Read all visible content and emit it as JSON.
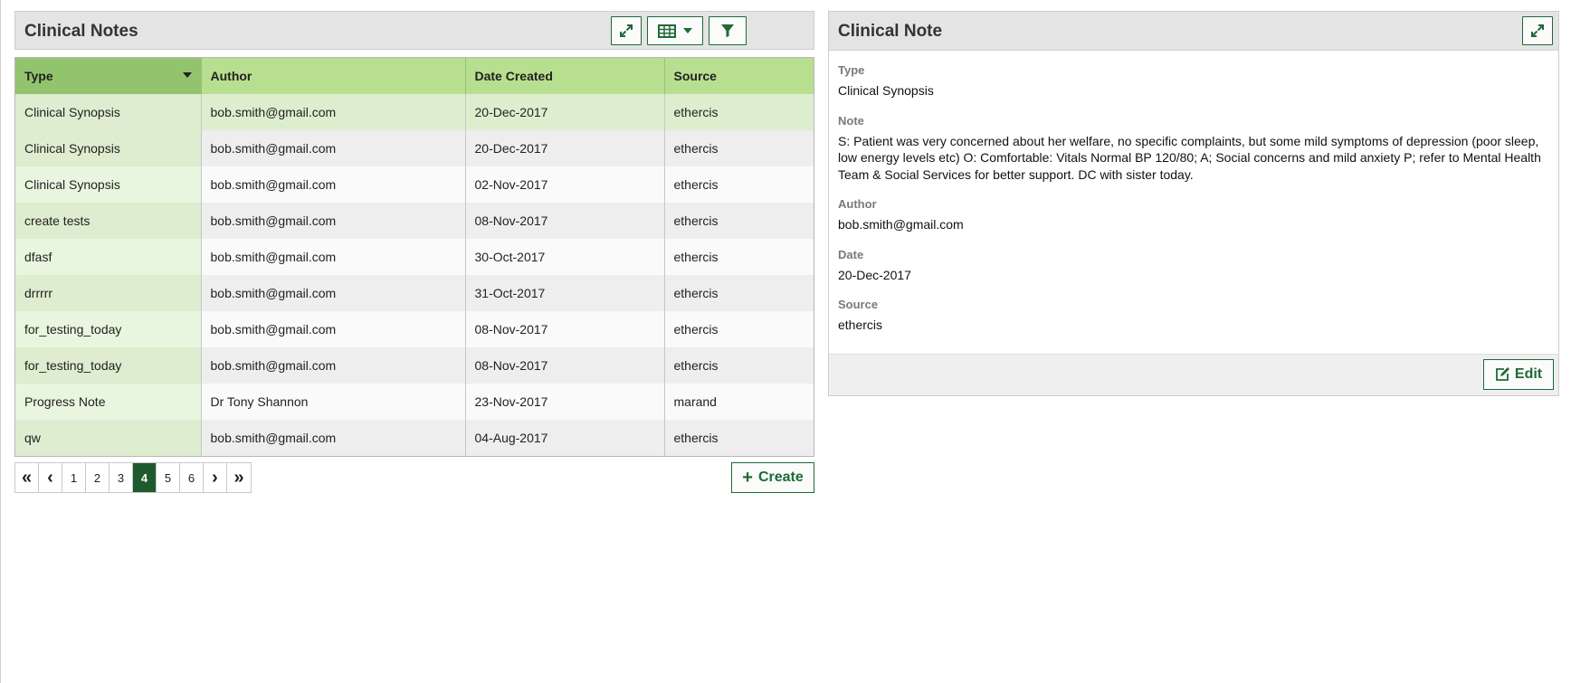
{
  "list_panel": {
    "title": "Clinical Notes",
    "columns": [
      "Type",
      "Author",
      "Date Created",
      "Source"
    ],
    "rows": [
      [
        "Clinical Synopsis",
        "bob.smith@gmail.com",
        "20-Dec-2017",
        "ethercis"
      ],
      [
        "Clinical Synopsis",
        "bob.smith@gmail.com",
        "20-Dec-2017",
        "ethercis"
      ],
      [
        "Clinical Synopsis",
        "bob.smith@gmail.com",
        "02-Nov-2017",
        "ethercis"
      ],
      [
        "create tests",
        "bob.smith@gmail.com",
        "08-Nov-2017",
        "ethercis"
      ],
      [
        "dfasf",
        "bob.smith@gmail.com",
        "30-Oct-2017",
        "ethercis"
      ],
      [
        "drrrrr",
        "bob.smith@gmail.com",
        "31-Oct-2017",
        "ethercis"
      ],
      [
        "for_testing_today",
        "bob.smith@gmail.com",
        "08-Nov-2017",
        "ethercis"
      ],
      [
        "for_testing_today",
        "bob.smith@gmail.com",
        "08-Nov-2017",
        "ethercis"
      ],
      [
        "Progress Note",
        "Dr Tony Shannon",
        "23-Nov-2017",
        "marand"
      ],
      [
        "qw",
        "bob.smith@gmail.com",
        "04-Aug-2017",
        "ethercis"
      ]
    ],
    "pagination": {
      "first": "«",
      "prev": "‹",
      "pages": [
        "1",
        "2",
        "3",
        "4",
        "5",
        "6"
      ],
      "current": "4",
      "next": "›",
      "last": "»"
    },
    "create_label": "Create"
  },
  "detail_panel": {
    "title": "Clinical Note",
    "fields": [
      {
        "label": "Type",
        "value": "Clinical Synopsis"
      },
      {
        "label": "Note",
        "value": "S: Patient was very concerned about her welfare, no specific complaints, but some mild symptoms of depression (poor sleep, low energy levels etc) O: Comfortable: Vitals Normal BP 120/80; A; Social concerns and mild anxiety P; refer to Mental Health Team & Social Services for better support. DC with sister today."
      },
      {
        "label": "Author",
        "value": "bob.smith@gmail.com"
      },
      {
        "label": "Date",
        "value": "20-Dec-2017"
      },
      {
        "label": "Source",
        "value": "ethercis"
      }
    ],
    "edit_label": "Edit"
  },
  "colors": {
    "accent": "#1f6a36",
    "header_green": "#b8df8f",
    "sorted_header_green": "#92c46e",
    "active_page": "#1f5a2f"
  },
  "icons": {
    "expand": "expand-icon",
    "table": "table-columns-icon",
    "filter": "filter-icon",
    "create": "plus-icon",
    "edit": "edit-icon"
  }
}
